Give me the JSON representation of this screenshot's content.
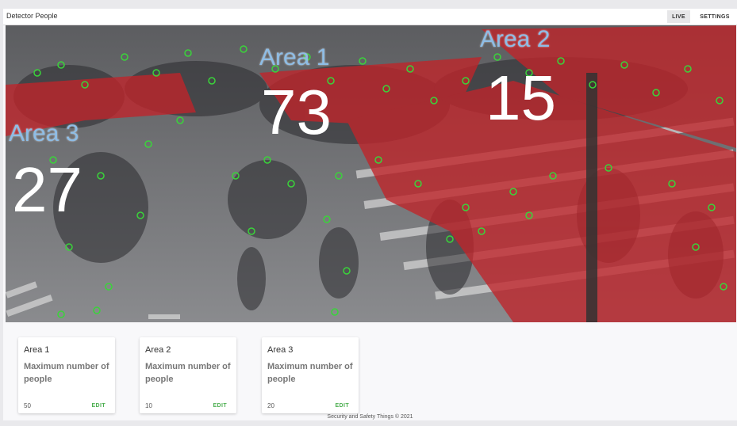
{
  "header": {
    "title": "Detector People",
    "tabs": [
      {
        "label": "LIVE",
        "active": true
      },
      {
        "label": "SETTINGS",
        "active": false
      }
    ]
  },
  "overlays": [
    {
      "name": "Area 1",
      "count": "73"
    },
    {
      "name": "Area 2",
      "count": "15"
    },
    {
      "name": "Area 3",
      "count": "27"
    }
  ],
  "cards": [
    {
      "title": "Area 1",
      "description": "Maximum number of people",
      "value": "50",
      "action": "EDIT"
    },
    {
      "title": "Area 2",
      "description": "Maximum number of people",
      "value": "10",
      "action": "EDIT"
    },
    {
      "title": "Area 3",
      "description": "Maximum number of people",
      "value": "20",
      "action": "EDIT"
    }
  ],
  "footer": "Security and Safety Things © 2021",
  "colors": {
    "zone_fill": "#c0242a",
    "detection_ring": "#3ad43a",
    "label": "#8ebde6",
    "edit": "#4caf50"
  }
}
